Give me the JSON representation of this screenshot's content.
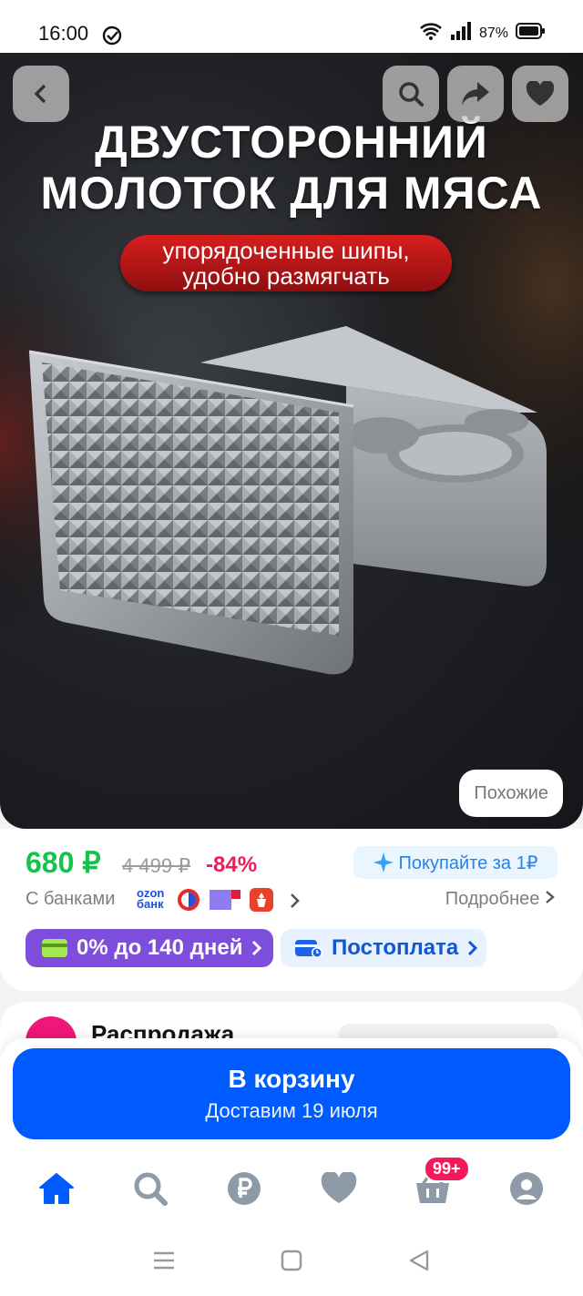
{
  "status": {
    "time": "16:00",
    "battery": "87%"
  },
  "hero": {
    "title_line1": "ДВУСТОРОННИЙ",
    "title_line2": "МОЛОТОК ДЛЯ МЯСА",
    "pill_line1": "упорядоченные шипы,",
    "pill_line2": "удобно размягчать",
    "similar_label": "Похожие"
  },
  "price": {
    "current": "680 ₽",
    "old": "4 499 ₽",
    "discount": "-84%",
    "buy_for_one": "Покупайте за 1₽",
    "banks_label": "С банками",
    "ozon_bank_top": "ozon",
    "ozon_bank_bottom": "банк",
    "more_label": "Подробнее",
    "credit_label": "0% до 140 дней",
    "postpay_label": "Постоплата"
  },
  "section": {
    "sale_label": "Распродажа"
  },
  "cart": {
    "label": "В корзину",
    "delivery": "Доставим 19 июля"
  },
  "nav": {
    "cart_badge": "99+"
  },
  "colors": {
    "accent": "#005bff",
    "price": "#10c44c",
    "discount": "#f8175a",
    "credit": "#7d4ddb"
  }
}
